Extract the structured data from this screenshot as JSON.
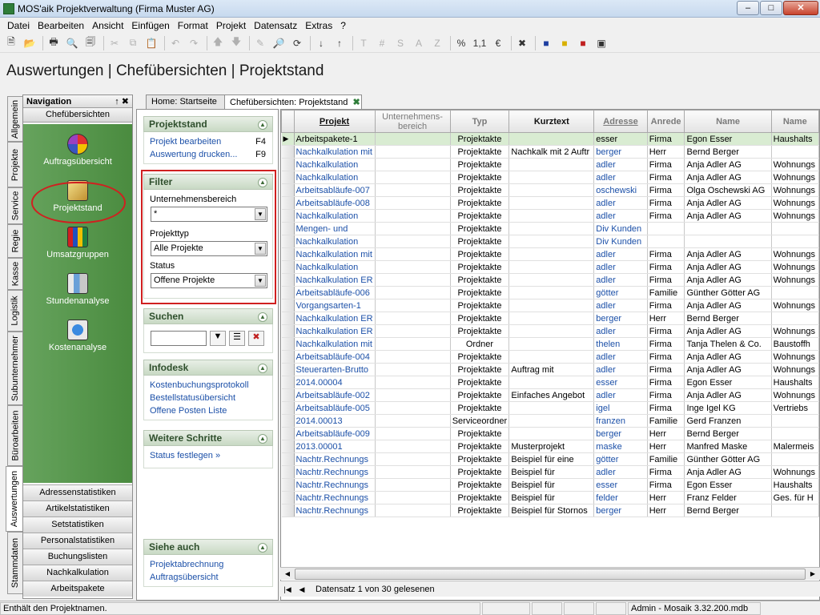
{
  "window": {
    "title": "MOS'aik Projektverwaltung (Firma Muster AG)"
  },
  "menu": [
    "Datei",
    "Bearbeiten",
    "Ansicht",
    "Einfügen",
    "Format",
    "Projekt",
    "Datensatz",
    "Extras",
    "?"
  ],
  "page_title": "Auswertungen | Chefübersichten | Projektstand",
  "vertical_tabs": [
    "Allgemein",
    "Projekte",
    "Service",
    "Regie",
    "Kasse",
    "Logistik",
    "Subunternehmer",
    "Büroarbeiten",
    "Auswertungen",
    "Stammdaten"
  ],
  "nav": {
    "title": "Navigation",
    "pin": "↑ ✖",
    "group": "Chefübersichten",
    "entries": [
      "Auftragsübersicht",
      "Projektstand",
      "Umsatzgruppen",
      "Stundenanalyse",
      "Kostenanalyse"
    ],
    "buttons": [
      "Adressenstatistiken",
      "Artikelstatistiken",
      "Setstatistiken",
      "Personalstatistiken",
      "Buchungslisten",
      "Nachkalkulation",
      "Arbeitspakete"
    ]
  },
  "tabs": [
    "Home: Startseite",
    "Chefübersichten: Projektstand"
  ],
  "task": {
    "projektstand": {
      "title": "Projektstand",
      "links": [
        {
          "label": "Projekt bearbeiten",
          "key": "F4"
        },
        {
          "label": "Auswertung drucken...",
          "key": "F9"
        }
      ]
    },
    "filter": {
      "title": "Filter",
      "unternehmensbereich_label": "Unternehmensbereich",
      "unternehmensbereich_value": "*",
      "projekttyp_label": "Projekttyp",
      "projekttyp_value": "Alle Projekte",
      "status_label": "Status",
      "status_value": "Offene Projekte"
    },
    "suchen": {
      "title": "Suchen",
      "value": ""
    },
    "infodesk": {
      "title": "Infodesk",
      "links": [
        "Kostenbuchungsprotokoll",
        "Bestellstatusübersicht",
        "Offene Posten Liste"
      ]
    },
    "weitere": {
      "title": "Weitere Schritte",
      "links": [
        "Status festlegen »"
      ]
    },
    "siehe": {
      "title": "Siehe auch",
      "links": [
        "Projektabrechnung",
        "Auftragsübersicht"
      ]
    }
  },
  "grid": {
    "columns": [
      "Projekt",
      "Unternehmens-\nbereich",
      "Typ",
      "Kurztext",
      "Adresse",
      "Anrede",
      "Name",
      "Name"
    ],
    "rows": [
      [
        "Arbeitspakete-1",
        "",
        "Projektakte",
        "",
        "esser",
        "Firma",
        "Egon Esser",
        "Haushalts"
      ],
      [
        "Nachkalkulation mit",
        "",
        "Projektakte",
        "Nachkalk mit 2 Auftr",
        "berger",
        "Herr",
        "Bernd Berger",
        ""
      ],
      [
        "Nachkalkulation",
        "",
        "Projektakte",
        "",
        "adler",
        "Firma",
        "Anja Adler AG",
        "Wohnungs"
      ],
      [
        "Nachkalkulation",
        "",
        "Projektakte",
        "",
        "adler",
        "Firma",
        "Anja Adler AG",
        "Wohnungs"
      ],
      [
        "Arbeitsabläufe-007",
        "",
        "Projektakte",
        "",
        "oschewski",
        "Firma",
        "Olga Oschewski AG",
        "Wohnungs"
      ],
      [
        "Arbeitsabläufe-008",
        "",
        "Projektakte",
        "",
        "adler",
        "Firma",
        "Anja Adler AG",
        "Wohnungs"
      ],
      [
        "Nachkalkulation",
        "",
        "Projektakte",
        "",
        "adler",
        "Firma",
        "Anja Adler AG",
        "Wohnungs"
      ],
      [
        "Mengen- und",
        "",
        "Projektakte",
        "",
        "Div Kunden",
        "",
        "",
        ""
      ],
      [
        "Nachkalkulation",
        "",
        "Projektakte",
        "",
        "Div Kunden",
        "",
        "",
        ""
      ],
      [
        "Nachkalkulation mit",
        "",
        "Projektakte",
        "",
        "adler",
        "Firma",
        "Anja Adler AG",
        "Wohnungs"
      ],
      [
        "Nachkalkulation",
        "",
        "Projektakte",
        "",
        "adler",
        "Firma",
        "Anja Adler AG",
        "Wohnungs"
      ],
      [
        "Nachkalkulation ER",
        "",
        "Projektakte",
        "",
        "adler",
        "Firma",
        "Anja Adler AG",
        "Wohnungs"
      ],
      [
        "Arbeitsabläufe-006",
        "",
        "Projektakte",
        "",
        "götter",
        "Familie",
        "Günther Götter AG",
        ""
      ],
      [
        "Vorgangsarten-1",
        "",
        "Projektakte",
        "",
        "adler",
        "Firma",
        "Anja Adler AG",
        "Wohnungs"
      ],
      [
        "Nachkalkulation ER",
        "",
        "Projektakte",
        "",
        "berger",
        "Herr",
        "Bernd Berger",
        ""
      ],
      [
        "Nachkalkulation ER",
        "",
        "Projektakte",
        "",
        "adler",
        "Firma",
        "Anja Adler AG",
        "Wohnungs"
      ],
      [
        "Nachkalkulation mit",
        "",
        "Ordner",
        "",
        "thelen",
        "Firma",
        "Tanja Thelen & Co.",
        "Baustoffh"
      ],
      [
        "Arbeitsabläufe-004",
        "",
        "Projektakte",
        "",
        "adler",
        "Firma",
        "Anja Adler AG",
        "Wohnungs"
      ],
      [
        "Steuerarten-Brutto",
        "",
        "Projektakte",
        "Auftrag mit",
        "adler",
        "Firma",
        "Anja Adler AG",
        "Wohnungs"
      ],
      [
        "2014.00004",
        "",
        "Projektakte",
        "",
        "esser",
        "Firma",
        "Egon Esser",
        "Haushalts"
      ],
      [
        "Arbeitsabläufe-002",
        "",
        "Projektakte",
        "Einfaches Angebot",
        "adler",
        "Firma",
        "Anja Adler AG",
        "Wohnungs"
      ],
      [
        "Arbeitsabläufe-005",
        "",
        "Projektakte",
        "",
        "igel",
        "Firma",
        "Inge Igel KG",
        "Vertriebs"
      ],
      [
        "2014.00013",
        "",
        "Serviceordner",
        "",
        "franzen",
        "Familie",
        "Gerd Franzen",
        ""
      ],
      [
        "Arbeitsabläufe-009",
        "",
        "Projektakte",
        "",
        "berger",
        "Herr",
        "Bernd Berger",
        ""
      ],
      [
        "2013.00001",
        "",
        "Projektakte",
        "Musterprojekt",
        "maske",
        "Herr",
        "Manfred Maske",
        "Malermeis"
      ],
      [
        "Nachtr.Rechnungs",
        "",
        "Projektakte",
        "Beispiel für eine",
        "götter",
        "Familie",
        "Günther Götter AG",
        ""
      ],
      [
        "Nachtr.Rechnungs",
        "",
        "Projektakte",
        "Beispiel für",
        "adler",
        "Firma",
        "Anja Adler AG",
        "Wohnungs"
      ],
      [
        "Nachtr.Rechnungs",
        "",
        "Projektakte",
        "Beispiel für",
        "esser",
        "Firma",
        "Egon Esser",
        "Haushalts"
      ],
      [
        "Nachtr.Rechnungs",
        "",
        "Projektakte",
        "Beispiel für",
        "felder",
        "Herr",
        "Franz Felder",
        "Ges. für H"
      ],
      [
        "Nachtr.Rechnungs",
        "",
        "Projektakte",
        "Beispiel für Stornos",
        "berger",
        "Herr",
        "Bernd Berger",
        ""
      ]
    ],
    "record_text": "Datensatz 1 von 30 gelesenen"
  },
  "status": {
    "left": "Enthält den Projektnamen.",
    "right": "Admin - Mosaik 3.32.200.mdb"
  }
}
